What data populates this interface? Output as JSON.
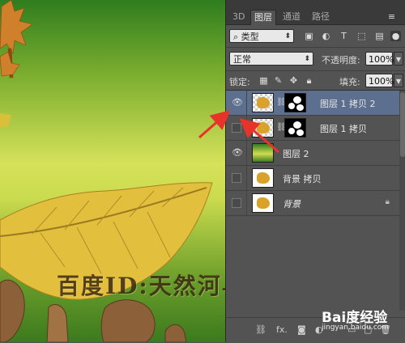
{
  "watermark": "百度ID:天然河与你相约",
  "panel": {
    "tabs": [
      {
        "label": "3D"
      },
      {
        "label": "图层"
      },
      {
        "label": "通道"
      },
      {
        "label": "路径"
      }
    ],
    "filter_kind": "类型",
    "blend_mode": "正常",
    "opacity_label": "不透明度:",
    "opacity_value": "100%",
    "lock_label": "锁定:",
    "fill_label": "填充:",
    "fill_value": "100%",
    "layers": [
      {
        "name": "图层 1 拷贝 2",
        "visible": true,
        "selected": true,
        "has_mask": true
      },
      {
        "name": "图层 1 拷贝",
        "visible": false,
        "selected": false,
        "has_mask": true
      },
      {
        "name": "图层 2",
        "visible": true,
        "selected": false,
        "has_mask": false
      },
      {
        "name": "背景 拷贝",
        "visible": false,
        "selected": false,
        "has_mask": false
      },
      {
        "name": "背景",
        "visible": false,
        "selected": false,
        "has_mask": false,
        "locked": true
      }
    ],
    "bottom_fx": "fx."
  },
  "site_badge": {
    "brand": "Bai度经验",
    "url": "jingyan.baidu.com"
  },
  "colors": {
    "selection": "#5c6f8e",
    "annotation_arrow": "#e8332a",
    "panel_bg": "#535353"
  }
}
